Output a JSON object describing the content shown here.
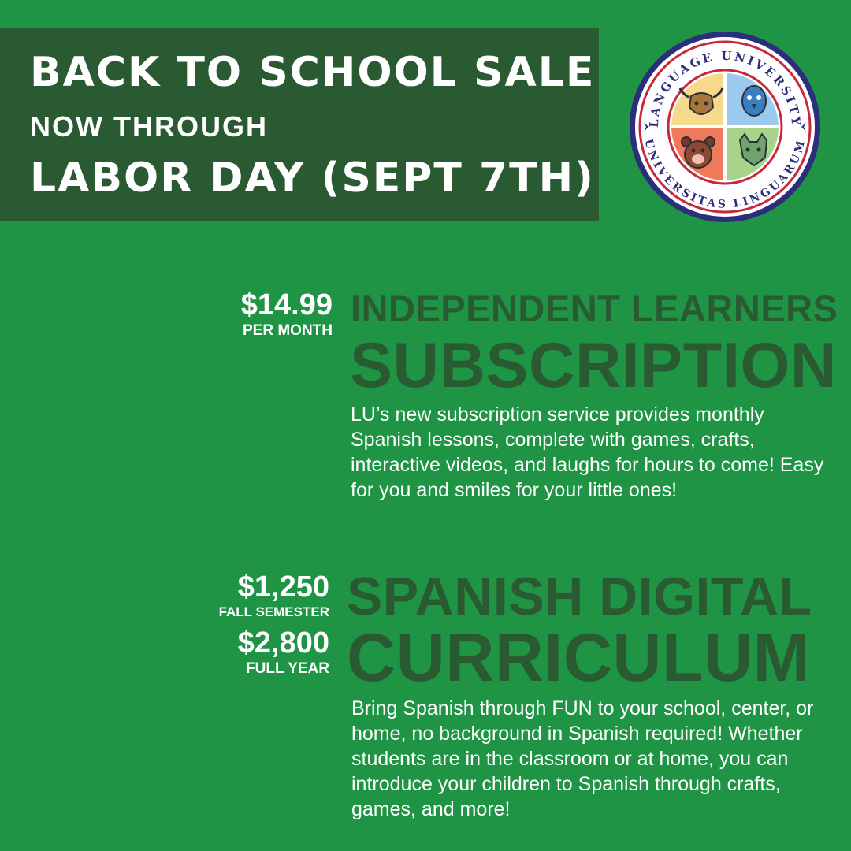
{
  "banner": {
    "line1": "BACK TO SCHOOL SALE",
    "line2": "NOW THROUGH",
    "line3": "LABOR DAY (SEPT 7TH)"
  },
  "seal": {
    "top_text": "LANGUAGE UNIVERSITY",
    "bottom_text": "UNIVERSITAS LINGUARUM"
  },
  "offer1": {
    "price": "$14.99",
    "price_unit": "PER MONTH",
    "heading_line1": "INDEPENDENT LEARNERS",
    "heading_line2": "SUBSCRIPTION",
    "description": "LU’s new subscription service provides monthly Spanish lessons, complete with games, crafts, interactive videos, and laughs for hours to come! Easy for you and smiles for your little ones!"
  },
  "offer2": {
    "price1": "$1,250",
    "price1_unit": "FALL SEMESTER",
    "price2": "$2,800",
    "price2_unit": "FULL YEAR",
    "heading_line1": "SPANISH DIGITAL",
    "heading_line2": "CURRICULUM",
    "description": "Bring Spanish through FUN to your school, center, or home, no background in Spanish required! Whether students are in the classroom or at home, you can introduce your children to Spanish through crafts, games, and more!"
  },
  "colors": {
    "background": "#1f9445",
    "dark_green": "#2a5a31",
    "seal_red": "#c8283c",
    "seal_navy": "#2b2f7a"
  }
}
